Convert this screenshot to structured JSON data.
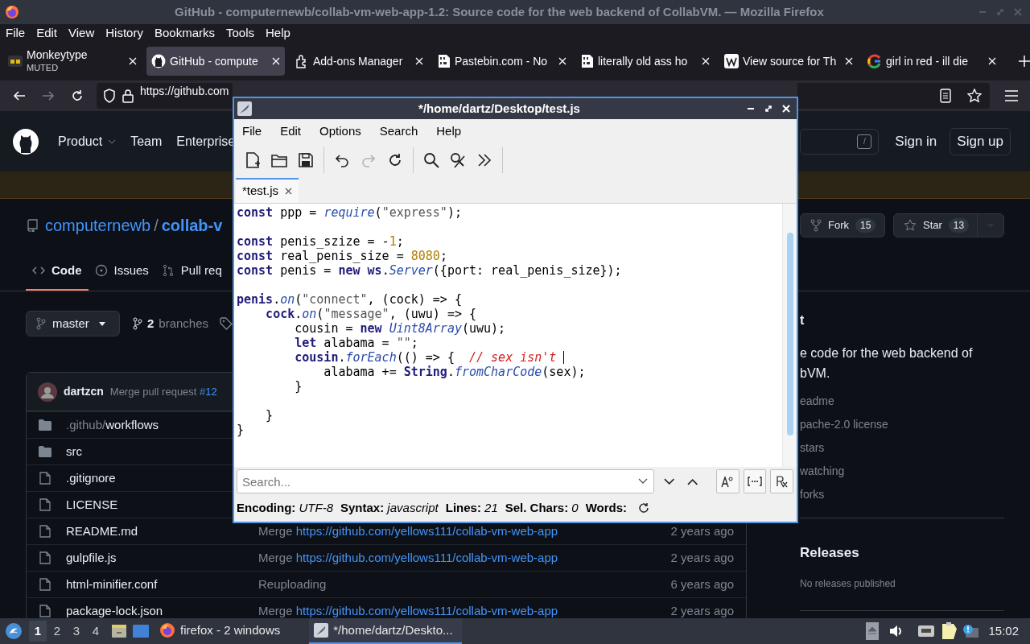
{
  "firefox": {
    "title": "GitHub - computernewb/collab-vm-web-app-1.2: Source code for the web backend of CollabVM. — Mozilla Firefox",
    "menu": [
      "File",
      "Edit",
      "View",
      "History",
      "Bookmarks",
      "Tools",
      "Help"
    ],
    "tabs": [
      {
        "kind": "monkeytype",
        "title": "Monkeytype",
        "subtitle": "MUTED",
        "selected": false
      },
      {
        "kind": "github",
        "title": "GitHub - compute",
        "selected": true
      },
      {
        "kind": "addons",
        "title": "Add-ons Manager",
        "selected": false
      },
      {
        "kind": "pastebin",
        "title": "Pastebin.com - No",
        "selected": false
      },
      {
        "kind": "pastebin",
        "title": "literally old ass ho",
        "selected": false
      },
      {
        "kind": "wiki",
        "title": "View source for Th",
        "selected": false
      },
      {
        "kind": "google",
        "title": "girl in red - ill die",
        "selected": false
      }
    ],
    "url": "https://github.com"
  },
  "github": {
    "nav": [
      {
        "label": "Product",
        "dropdown": true
      },
      {
        "label": "Team",
        "dropdown": false
      },
      {
        "label": "Enterprise",
        "dropdown": false
      }
    ],
    "search_key": "/",
    "sign_in": "Sign in",
    "sign_up": "Sign up",
    "owner": "computernewb",
    "separator": "/",
    "repo": "collab-v",
    "fork": {
      "label": "Fork",
      "count": "15"
    },
    "star": {
      "label": "Star",
      "count": "13"
    },
    "tabs": [
      {
        "label": "Code",
        "selected": true
      },
      {
        "label": "Issues",
        "selected": false
      },
      {
        "label": "Pull req",
        "selected": false
      }
    ],
    "branch": "master",
    "branches": {
      "count": "2",
      "label": "branches"
    },
    "commit": {
      "author": "dartzcn",
      "message": "Merge pull request",
      "link": "#12"
    },
    "files": [
      {
        "kind": "dir",
        "prefix": ".github/",
        "name": "workflows"
      },
      {
        "kind": "dir",
        "name": "src"
      },
      {
        "kind": "file",
        "name": ".gitignore"
      },
      {
        "kind": "file",
        "name": "LICENSE"
      },
      {
        "kind": "file",
        "name": "README.md",
        "message": "Merge",
        "link": "https://github.com/yellows111/collab-vm-web-app",
        "time": "2 years ago"
      },
      {
        "kind": "file",
        "name": "gulpfile.js",
        "message": "Merge",
        "link": "https://github.com/yellows111/collab-vm-web-app",
        "time": "2 years ago"
      },
      {
        "kind": "file",
        "name": "html-minifier.conf",
        "message": "Reuploading",
        "time": "6 years ago"
      },
      {
        "kind": "file",
        "name": "package-lock.json",
        "message": "Merge",
        "link": "https://github.com/yellows111/collab-vm-web-app",
        "time": "2 years ago"
      }
    ],
    "about": {
      "heading": "t",
      "description": "e code for the web backend of bVM.",
      "links": [
        "eadme",
        "pache-2.0 license",
        "stars",
        "watching",
        "forks"
      ]
    },
    "releases": {
      "heading": "Releases",
      "note": "No releases published"
    }
  },
  "editor": {
    "title": "*/home/dartz/Desktop/test.js",
    "menu": [
      "File",
      "Edit",
      "Options",
      "Search",
      "Help"
    ],
    "toolbar": [
      {
        "kind": "new",
        "disabled": false
      },
      {
        "kind": "open",
        "disabled": false
      },
      {
        "kind": "save",
        "disabled": false
      },
      {
        "kind": "sep"
      },
      {
        "kind": "undo",
        "disabled": false
      },
      {
        "kind": "redo",
        "disabled": true
      },
      {
        "kind": "reload",
        "disabled": false
      },
      {
        "kind": "sep"
      },
      {
        "kind": "find",
        "disabled": false
      },
      {
        "kind": "replace",
        "disabled": false
      },
      {
        "kind": "more",
        "disabled": false
      },
      {
        "kind": "sep"
      }
    ],
    "tab": {
      "label": "*test.js",
      "selected": true
    },
    "lines": [
      {
        "tokens": [
          {
            "t": "const",
            "kind": "keyword"
          },
          {
            "t": " ppp = ",
            "kind": "plain"
          },
          {
            "t": "require",
            "kind": "func"
          },
          {
            "t": "(",
            "kind": "plain"
          },
          {
            "t": "\"express\"",
            "kind": "string"
          },
          {
            "t": ");",
            "kind": "plain"
          }
        ]
      },
      {
        "kind": "blank"
      },
      {
        "tokens": [
          {
            "t": "const",
            "kind": "keyword"
          },
          {
            "t": " penis_szize = -",
            "kind": "plain"
          },
          {
            "t": "1",
            "kind": "number"
          },
          {
            "t": ";",
            "kind": "plain"
          }
        ]
      },
      {
        "tokens": [
          {
            "t": "const",
            "kind": "keyword"
          },
          {
            "t": " real_penis_size = ",
            "kind": "plain"
          },
          {
            "t": "8080",
            "kind": "number"
          },
          {
            "t": ";",
            "kind": "plain"
          }
        ]
      },
      {
        "tokens": [
          {
            "t": "const",
            "kind": "keyword"
          },
          {
            "t": " penis = ",
            "kind": "plain"
          },
          {
            "t": "new",
            "kind": "keyword"
          },
          {
            "t": " ws",
            "kind": "keyword"
          },
          {
            "t": ".",
            "kind": "plain"
          },
          {
            "t": "Server",
            "kind": "func"
          },
          {
            "t": "({port: real_penis_size});",
            "kind": "plain"
          }
        ]
      },
      {
        "kind": "blank"
      },
      {
        "tokens": [
          {
            "t": "penis",
            "kind": "keyword"
          },
          {
            "t": ".",
            "kind": "plain"
          },
          {
            "t": "on",
            "kind": "func"
          },
          {
            "t": "(",
            "kind": "plain"
          },
          {
            "t": "\"connect\"",
            "kind": "string"
          },
          {
            "t": ", (cock) => {",
            "kind": "plain"
          }
        ]
      },
      {
        "tokens": [
          {
            "t": "    cock",
            "kind": "keyword"
          },
          {
            "t": ".",
            "kind": "plain"
          },
          {
            "t": "on",
            "kind": "func"
          },
          {
            "t": "(",
            "kind": "plain"
          },
          {
            "t": "\"message\"",
            "kind": "string"
          },
          {
            "t": ", (uwu) => {",
            "kind": "plain"
          }
        ]
      },
      {
        "tokens": [
          {
            "t": "        cousin = ",
            "kind": "plain"
          },
          {
            "t": "new",
            "kind": "keyword"
          },
          {
            "t": " Uint8Array",
            "kind": "func"
          },
          {
            "t": "(uwu);",
            "kind": "plain"
          }
        ]
      },
      {
        "tokens": [
          {
            "t": "        let",
            "kind": "keyword"
          },
          {
            "t": " alabama = ",
            "kind": "plain"
          },
          {
            "t": "\"\"",
            "kind": "string"
          },
          {
            "t": ";",
            "kind": "plain"
          }
        ]
      },
      {
        "cursor": true,
        "tokens": [
          {
            "t": "        cousin",
            "kind": "keyword"
          },
          {
            "t": ".",
            "kind": "plain"
          },
          {
            "t": "forEach",
            "kind": "func"
          },
          {
            "t": "(() => {  ",
            "kind": "plain"
          },
          {
            "t": "// sex isn't ",
            "kind": "comment"
          }
        ]
      },
      {
        "tokens": [
          {
            "t": "            alabama += ",
            "kind": "plain"
          },
          {
            "t": "String",
            "kind": "keyword"
          },
          {
            "t": ".",
            "kind": "plain"
          },
          {
            "t": "fromCharCode",
            "kind": "func"
          },
          {
            "t": "(sex);",
            "kind": "plain"
          }
        ]
      },
      {
        "tokens": [
          {
            "t": "        }",
            "kind": "plain"
          }
        ]
      },
      {
        "kind": "blank"
      },
      {
        "tokens": [
          {
            "t": "    }",
            "kind": "plain"
          }
        ]
      },
      {
        "tokens": [
          {
            "t": "}",
            "kind": "plain"
          }
        ]
      }
    ],
    "search": {
      "placeholder": "Search..."
    },
    "status": [
      {
        "label": "Encoding:",
        "value": "UTF-8"
      },
      {
        "label": "Syntax:",
        "value": "javascript"
      },
      {
        "label": "Lines:",
        "value": "21"
      },
      {
        "label": "Sel. Chars:",
        "value": "0"
      },
      {
        "label": "Words:"
      }
    ]
  },
  "taskbar": {
    "workspaces": [
      {
        "label": "1",
        "selected": true
      },
      {
        "label": "2",
        "selected": false
      },
      {
        "label": "3",
        "selected": false
      },
      {
        "label": "4",
        "selected": false
      }
    ],
    "tasks": [
      {
        "kind": "firefox",
        "label": "firefox - 2 windows",
        "selected": false
      },
      {
        "kind": "editor",
        "label": "*/home/dartz/Deskto...",
        "selected": true
      }
    ],
    "clock": "15:02"
  }
}
